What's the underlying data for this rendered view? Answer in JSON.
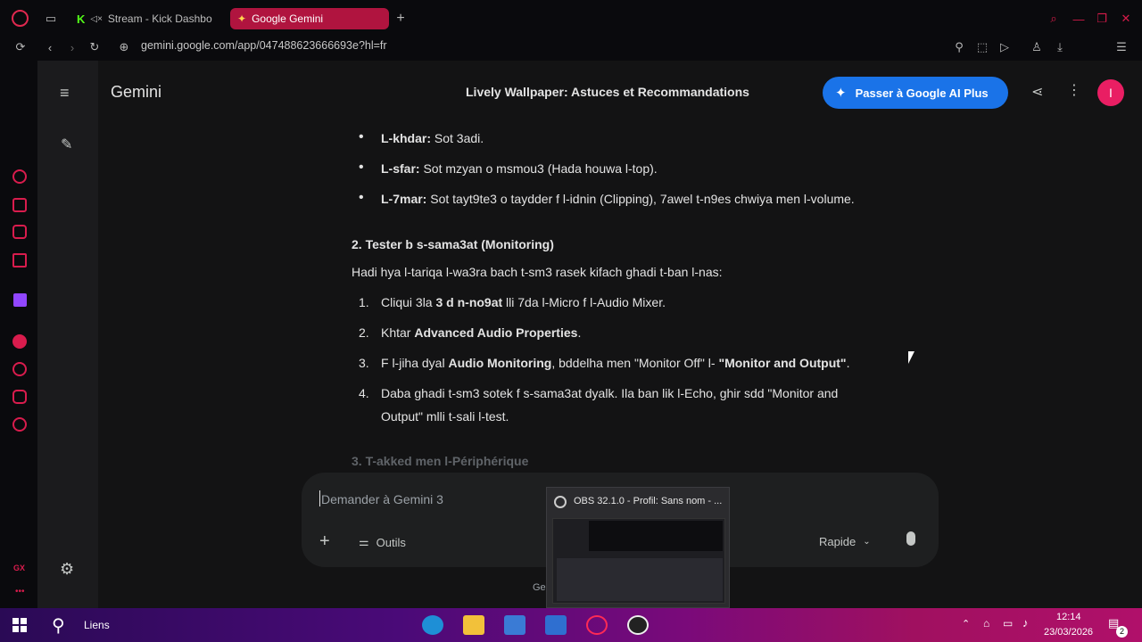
{
  "browser": {
    "tabs": [
      {
        "label": "Stream - Kick Dashboa",
        "active": false
      },
      {
        "label": "Google Gemini",
        "active": true
      }
    ],
    "url": "gemini.google.com/app/047488623666693e?hl=fr",
    "ai_label": "AI",
    "accent": "#b0143f"
  },
  "gemini": {
    "brand": "Gemini",
    "chat_title": "Lively Wallpaper: Astuces et Recommandations",
    "upgrade_label": "Passer à Google AI Plus",
    "avatar_initial": "I",
    "footer_fragment": "Ge"
  },
  "message": {
    "bullets": [
      {
        "term": "L-khdar:",
        "text": " Sot 3adi."
      },
      {
        "term": "L-sfar:",
        "text": " Sot mzyan o msmou3 (Hada houwa l-top)."
      },
      {
        "term": "L-7mar:",
        "text": " Sot tayt9te3 o taydder f l-idnin (Clipping), 7awel t-n9es chwiya men l-volume."
      }
    ],
    "section2_heading": "2. Tester b s-sama3at (Monitoring)",
    "section2_intro": "Hadi hya l-tariqa l-wa3ra bach t-sm3 rasek kifach ghadi t-ban l-nas:",
    "steps": [
      {
        "n": "1.",
        "a": "Cliqui 3la ",
        "b": "3 d n-no9at",
        "c": " lli 7da l-Micro f l-Audio Mixer."
      },
      {
        "n": "2.",
        "a": "Khtar ",
        "b": "Advanced Audio Properties",
        "c": "."
      },
      {
        "n": "3.",
        "a": "F l-jiha dyal ",
        "b": "Audio Monitoring",
        "c": ", bddelha men \"Monitor Off\" l- ",
        "d": "\"Monitor and Output\"",
        "e": "."
      },
      {
        "n": "4.",
        "line1": "Daba ghadi t-sm3 sotek f s-sama3at dyalk. Ila ban lik l-Echo, ghir sdd \"Monitor and",
        "line2": "Output\" mlli t-sali l-test."
      }
    ],
    "section3_heading": "3. T-akked men l-Périphérique"
  },
  "composer": {
    "placeholder": "Demander à Gemini 3",
    "tools_label": "Outils",
    "mode_label": "Rapide"
  },
  "thumbnail": {
    "title": "OBS 32.1.0 - Profil: Sans nom - ..."
  },
  "taskbar": {
    "search_label": "Liens",
    "time": "12:14",
    "date": "23/03/2026",
    "notification_count": "2"
  }
}
